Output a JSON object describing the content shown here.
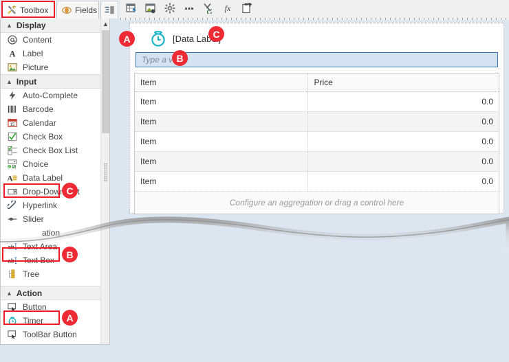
{
  "tabs": [
    {
      "label": "Toolbox",
      "icon": "tools-icon",
      "active": true
    },
    {
      "label": "Fields",
      "icon": "fields-icon",
      "active": false
    },
    {
      "label": "",
      "icon": "properties-icon",
      "active": false
    }
  ],
  "sidebar": {
    "groups": [
      {
        "title": "Display",
        "items": [
          {
            "label": "Content",
            "icon": "at-sign-icon"
          },
          {
            "label": "Label",
            "icon": "letter-a-icon"
          },
          {
            "label": "Picture",
            "icon": "picture-icon"
          }
        ]
      },
      {
        "title": "Input",
        "items": [
          {
            "label": "Auto-Complete",
            "icon": "lightning-icon"
          },
          {
            "label": "Barcode",
            "icon": "barcode-icon"
          },
          {
            "label": "Calendar",
            "icon": "calendar-icon"
          },
          {
            "label": "Check Box",
            "icon": "checkbox-icon"
          },
          {
            "label": "Check Box List",
            "icon": "checkbox-list-icon"
          },
          {
            "label": "Choice",
            "icon": "choice-icon"
          },
          {
            "label": "Data Label",
            "icon": "data-label-icon"
          },
          {
            "label": "Drop-Down List",
            "icon": "dropdown-icon"
          },
          {
            "label": "Hyperlink",
            "icon": "link-icon"
          },
          {
            "label": "Slider",
            "icon": "slider-icon"
          },
          {
            "label": "ation",
            "icon": "annotation-icon"
          },
          {
            "label": "Text Area",
            "icon": "text-area-icon"
          },
          {
            "label": "Text Box",
            "icon": "text-box-icon"
          },
          {
            "label": "Tree",
            "icon": "tree-icon"
          }
        ]
      },
      {
        "title": "Action",
        "items": [
          {
            "label": "Button",
            "icon": "button-icon"
          },
          {
            "label": "Timer",
            "icon": "timer-icon"
          },
          {
            "label": "ToolBar Button",
            "icon": "toolbar-button-icon"
          }
        ]
      }
    ]
  },
  "toolbar": {
    "buttons": [
      {
        "name": "insert-data-region-icon"
      },
      {
        "name": "insert-image-icon"
      },
      {
        "name": "settings-gear-icon"
      },
      {
        "name": "more-options-icon"
      },
      {
        "name": "cut-refresh-icon"
      },
      {
        "name": "function-fx-icon"
      },
      {
        "name": "paste-icon"
      }
    ]
  },
  "designer": {
    "data_label_text": "[Data Label]",
    "timer_icon": "timer-icon",
    "value_input": {
      "value": "",
      "placeholder": "Type a value"
    },
    "table": {
      "headers": [
        "Item",
        "Price"
      ],
      "rows": [
        [
          "Item",
          "0.0"
        ],
        [
          "Item",
          "0.0"
        ],
        [
          "Item",
          "0.0"
        ],
        [
          "Item",
          "0.0"
        ],
        [
          "Item",
          "0.0"
        ]
      ],
      "footer": "Configure an aggregation or drag a control here"
    }
  },
  "annotations": {
    "markers": [
      {
        "id": "A",
        "target": "timer-sidebar-item"
      },
      {
        "id": "B",
        "target": "text-box-sidebar-item"
      },
      {
        "id": "C",
        "target": "data-label-sidebar-item"
      },
      {
        "id": "A2",
        "label": "A",
        "target": "designer-timer-control"
      },
      {
        "id": "B2",
        "label": "B",
        "target": "designer-value-textbox"
      },
      {
        "id": "C2",
        "label": "C",
        "target": "designer-data-label"
      }
    ],
    "accent_color": "#ee2b34"
  }
}
